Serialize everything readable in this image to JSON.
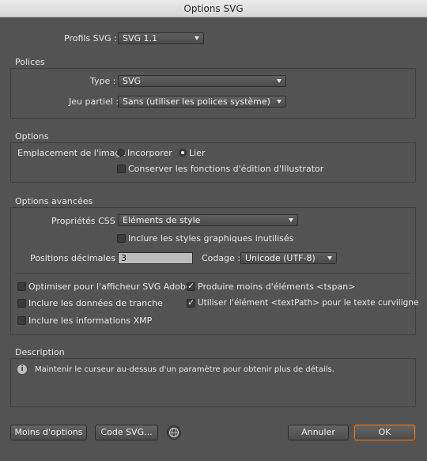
{
  "window": {
    "title": "Options SVG"
  },
  "profile": {
    "label": "Profils SVG :",
    "value": "SVG 1.1"
  },
  "fonts": {
    "title": "Polices",
    "type_label": "Type :",
    "type_value": "SVG",
    "subset_label": "Jeu partiel :",
    "subset_value": "Sans (utiliser les polices système)"
  },
  "options": {
    "title": "Options",
    "image_location_label": "Emplacement de l'image",
    "embed_label": "Incorporer",
    "link_label": "Lier",
    "preserve_label": "Conserver les fonctions d'édition d'Illustrator"
  },
  "advanced": {
    "title": "Options avancées",
    "css_label": "Propriétés CSS :",
    "css_value": "Eléments de style",
    "unused_styles_label": "Inclure les styles graphiques inutilisés",
    "decimal_label": "Positions décimales :",
    "decimal_value": "3",
    "encoding_label": "Codage :",
    "encoding_value": "Unicode (UTF-8)",
    "optimize_label": "Optimiser pour l'afficheur SVG Adobe",
    "slice_label": "Inclure les données de tranche",
    "xmp_label": "Inclure les informations XMP",
    "fewer_tspan_label": "Produire moins d'éléments <tspan>",
    "textpath_label": "Utiliser l'élément <textPath> pour le texte curviligne"
  },
  "description": {
    "title": "Description",
    "text": "Maintenir le curseur au-dessus d'un paramètre pour obtenir plus de détails."
  },
  "buttons": {
    "less_options": "Moins d'options",
    "svg_code": "Code SVG...",
    "cancel": "Annuler",
    "ok": "OK"
  },
  "icons": {
    "info": "i",
    "globe": "globe-icon"
  },
  "colors": {
    "dialog_bg": "#535353",
    "ok_focus": "#d9772a"
  }
}
